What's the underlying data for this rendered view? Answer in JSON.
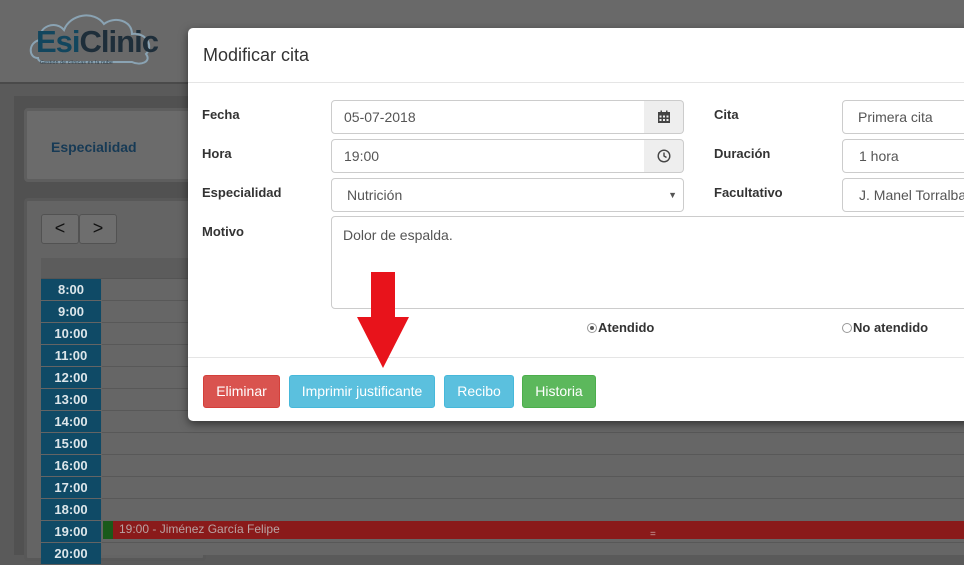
{
  "brand": {
    "logo_prefix": "Esi",
    "logo_suffix": "Clinic",
    "logo_tagline": "Gestión de clínicas en la nube"
  },
  "sidebar": {
    "specialty_label": "Especialidad",
    "prev_label": "<",
    "next_label": ">"
  },
  "calendar": {
    "hours": [
      "8:00",
      "9:00",
      "10:00",
      "11:00",
      "12:00",
      "13:00",
      "14:00",
      "15:00",
      "16:00",
      "17:00",
      "18:00",
      "19:00",
      "20:00"
    ],
    "event": {
      "text": "19:00 - Jiménez García Felipe",
      "handle": "="
    }
  },
  "modal": {
    "title": "Modificar cita",
    "fields": {
      "fecha": {
        "label": "Fecha",
        "value": "05-07-2018"
      },
      "hora": {
        "label": "Hora",
        "value": "19:00"
      },
      "especialidad": {
        "label": "Especialidad",
        "value": "Nutrición"
      },
      "motivo": {
        "label": "Motivo",
        "value": "Dolor de espalda."
      },
      "cita": {
        "label": "Cita",
        "value": "Primera cita"
      },
      "duracion": {
        "label": "Duración",
        "value": "1 hora"
      },
      "facultativo": {
        "label": "Facultativo",
        "value": "J. Manel Torralba"
      }
    },
    "status_options": [
      {
        "label": "Atendido",
        "checked": true
      },
      {
        "label": "No atendido",
        "checked": false
      }
    ],
    "buttons": {
      "eliminar": "Eliminar",
      "imprimir": "Imprimir justificante",
      "recibo": "Recibo",
      "historia": "Historia"
    }
  },
  "colors": {
    "danger": "#d9534f",
    "info": "#5bc0de",
    "success": "#5cb85c",
    "annotation_arrow": "#e8131b",
    "time_slot": "#0f4a66"
  },
  "icons": {
    "fecha_addon": "calendar-icon",
    "hora_addon": "clock-icon"
  }
}
